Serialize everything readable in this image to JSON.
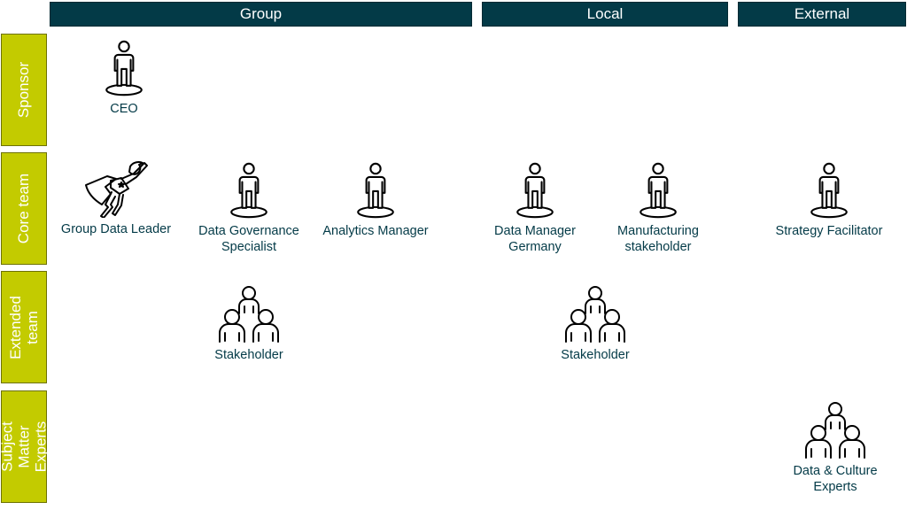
{
  "columns": [
    {
      "label": "Group"
    },
    {
      "label": "Local"
    },
    {
      "label": "External"
    }
  ],
  "rows": [
    {
      "label": "Sponsor"
    },
    {
      "label": "Core team"
    },
    {
      "label": "Extended team"
    },
    {
      "label": "Subject Matter Experts"
    }
  ],
  "roles": {
    "ceo": {
      "label": "CEO",
      "icon": "person-standing-icon"
    },
    "group_data_leader": {
      "label": "Group Data Leader",
      "icon": "superhero-icon"
    },
    "data_governance_specialist": {
      "label_line1": "Data Governance",
      "label_line2": "Specialist",
      "icon": "person-standing-icon"
    },
    "analytics_manager": {
      "label": "Analytics Manager",
      "icon": "person-standing-icon"
    },
    "data_manager_germany": {
      "label_line1": "Data Manager",
      "label_line2": "Germany",
      "icon": "person-standing-icon"
    },
    "manufacturing_stakeholder": {
      "label_line1": "Manufacturing",
      "label_line2": "stakeholder",
      "icon": "person-standing-icon"
    },
    "strategy_facilitator": {
      "label": "Strategy Facilitator",
      "icon": "person-standing-icon"
    },
    "group_stakeholder": {
      "label": "Stakeholder",
      "icon": "group-icon"
    },
    "local_stakeholder": {
      "label": "Stakeholder",
      "icon": "group-icon"
    },
    "data_culture_experts": {
      "label_line1": "Data & Culture",
      "label_line2": "Experts",
      "icon": "group-icon"
    }
  },
  "colors": {
    "column_header": "#033a47",
    "row_header": "#c3cb00",
    "label_text": "#033a47"
  }
}
